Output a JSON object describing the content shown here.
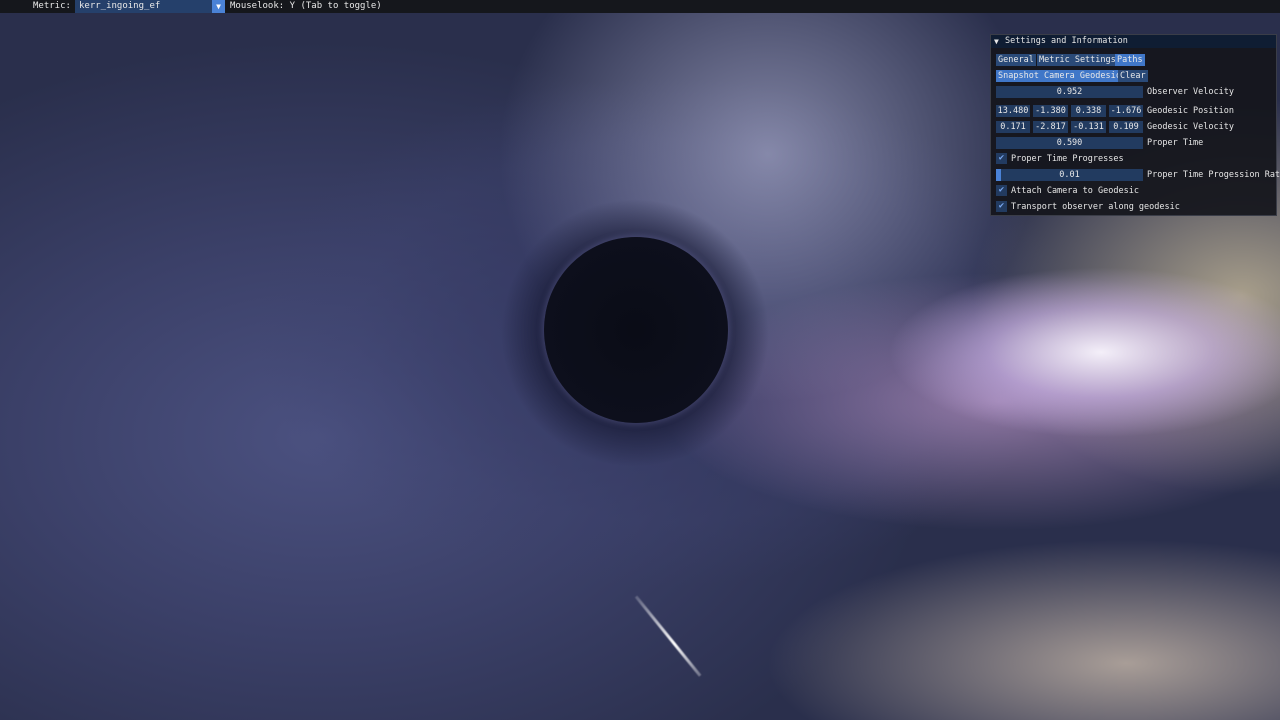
{
  "menubar": {
    "metric_label": "Metric:",
    "metric_value": "kerr_ingoing_ef",
    "metric_arrow": "▼",
    "mouselook": "Mouselook: Y (Tab to toggle)"
  },
  "panel": {
    "title_arrow": "▼",
    "title": "Settings and Information",
    "tabs": [
      {
        "label": "General",
        "active": false
      },
      {
        "label": "Metric Settings",
        "active": false
      },
      {
        "label": "Paths",
        "active": true
      }
    ],
    "buttons": {
      "snapshot": "Snapshot Camera Geodesic",
      "clear": "Clear"
    },
    "observer_velocity": {
      "value": "0.952",
      "label": "Observer Velocity"
    },
    "geodesic_position": {
      "values": [
        "13.480",
        "-1.380",
        "0.338",
        "-1.676"
      ],
      "label": "Geodesic Position"
    },
    "geodesic_velocity": {
      "values": [
        "0.171",
        "-2.817",
        "-0.131",
        "0.109"
      ],
      "label": "Geodesic Velocity"
    },
    "proper_time": {
      "value": "0.590",
      "label": "Proper Time"
    },
    "proper_time_progresses": {
      "checked": true,
      "label": "Proper Time Progresses"
    },
    "progression_rate": {
      "value": "0.01",
      "label": "Proper Time Progession Rate"
    },
    "attach_camera": {
      "checked": true,
      "label": "Attach Camera to Geodesic"
    },
    "transport_observer": {
      "checked": true,
      "label": "Transport observer along geodesic"
    },
    "check_glyph": "✔"
  },
  "colors": {
    "accent": "#4a82d6",
    "frame_bg": "#223b60",
    "panel_bg": "#14161c"
  }
}
